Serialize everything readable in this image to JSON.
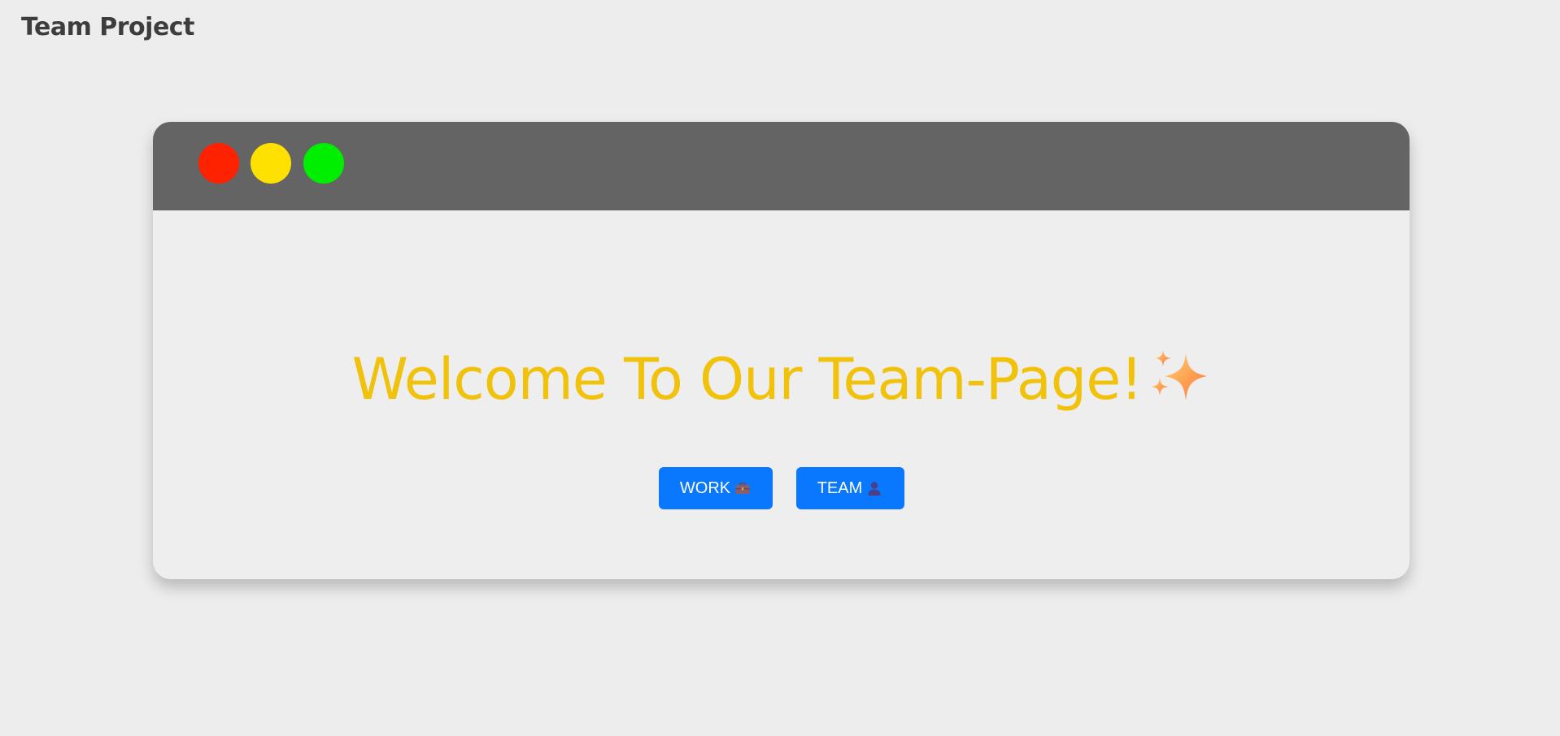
{
  "page": {
    "title": "Team Project"
  },
  "window": {
    "controls": [
      {
        "name": "close",
        "color": "#ff2200"
      },
      {
        "name": "minimize",
        "color": "#ffe100"
      },
      {
        "name": "maximize",
        "color": "#00ee00"
      }
    ]
  },
  "hero": {
    "heading": "Welcome To Our Team-Page!",
    "heading_icon": "sparkles-icon",
    "heading_color": "#f0c20c"
  },
  "buttons": {
    "accent_color": "#0a78fe",
    "work": {
      "label": "WORK",
      "icon": "briefcase-icon"
    },
    "team": {
      "label": "TEAM",
      "icon": "person-icon"
    }
  }
}
